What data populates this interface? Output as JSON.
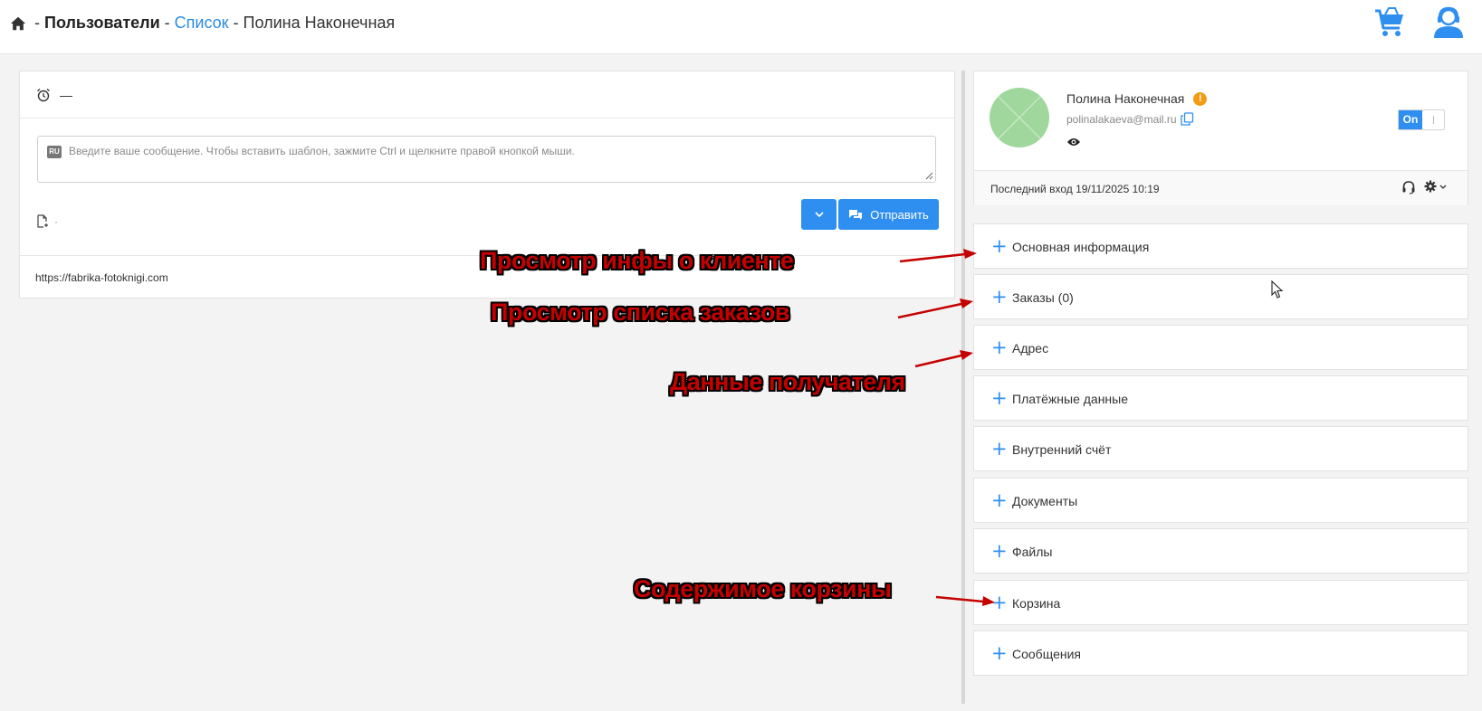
{
  "header": {
    "crumb_users": "Пользователи",
    "crumb_list": "Список",
    "crumb_current": "Полина Наконечная",
    "separator": "-"
  },
  "chat": {
    "dash": "—",
    "lang": "RU",
    "placeholder": "Введите ваше сообщение. Чтобы вставить шаблон, зажмите Ctrl и щелкните правой кнопкой мыши.",
    "attach_hint": "·",
    "send_label": "Отправить",
    "site_url": "https://fabrika-fotoknigi.com"
  },
  "profile": {
    "name": "Полина Наконечная",
    "warn_symbol": "!",
    "email": "polinalakaeva@mail.ru",
    "toggle_on": "On",
    "last_login_label": "Последний вход",
    "last_login_value": "19/11/2025 10:19"
  },
  "sections": [
    {
      "plus": "+",
      "label": "Основная информация"
    },
    {
      "plus": "+",
      "label": "Заказы (0)"
    },
    {
      "plus": "+",
      "label": "Адрес"
    },
    {
      "plus": "+",
      "label": "Платёжные данные"
    },
    {
      "plus": "+",
      "label": "Внутренний счёт"
    },
    {
      "plus": "+",
      "label": "Документы"
    },
    {
      "plus": "+",
      "label": "Файлы"
    },
    {
      "plus": "+",
      "label": "Корзина"
    },
    {
      "plus": "+",
      "label": "Сообщения"
    }
  ],
  "annotations": {
    "a1": "Просмотр инфы о клиенте",
    "a2": "Просмотр списка заказов",
    "a3": "Данные получателя",
    "a4": "Содержимое корзины"
  },
  "colors": {
    "accent": "#2f8ff0",
    "annotation": "#c50000",
    "avatar": "#9fd79c",
    "warning": "#f39c12"
  },
  "icons": [
    "home-icon",
    "cart-icon",
    "user-support-icon",
    "alarm-clock-icon",
    "attach-file-icon",
    "chevron-down-icon",
    "chat-bubbles-icon",
    "copy-icon",
    "eye-icon",
    "headset-icon",
    "gear-icon"
  ]
}
